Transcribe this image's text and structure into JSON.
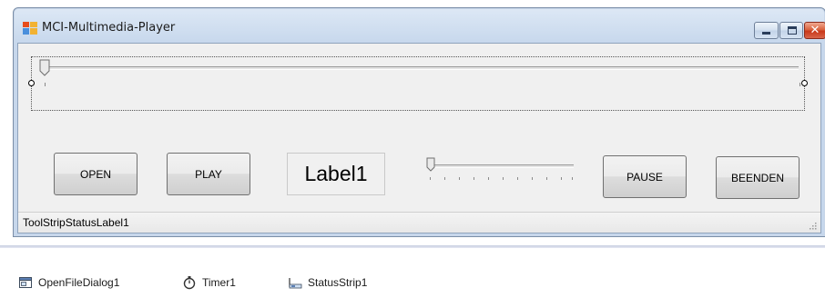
{
  "window": {
    "title": "MCI-Multimedia-Player",
    "icon": "form-icon",
    "controls": [
      "minimize-icon",
      "maximize-icon",
      "close-icon"
    ],
    "close_glyph": "✕"
  },
  "form": {
    "buttons": {
      "open": "OPEN",
      "play": "PLAY",
      "pause": "PAUSE",
      "beenden": "BEENDEN"
    },
    "label1": "Label1",
    "position_trackbar": {
      "value": 0
    },
    "volume_trackbar": {
      "value": 0
    },
    "status_label": "ToolStripStatusLabel1"
  },
  "tray": {
    "items": [
      {
        "label": "OpenFileDialog1",
        "icon": "open-file-dialog-icon"
      },
      {
        "label": "Timer1",
        "icon": "timer-icon"
      },
      {
        "label": "StatusStrip1",
        "icon": "status-strip-icon"
      }
    ]
  },
  "colors": {
    "title_bar": "#c6d7ec",
    "form_background": "#f0f0f0",
    "close_button": "#c9381a"
  }
}
